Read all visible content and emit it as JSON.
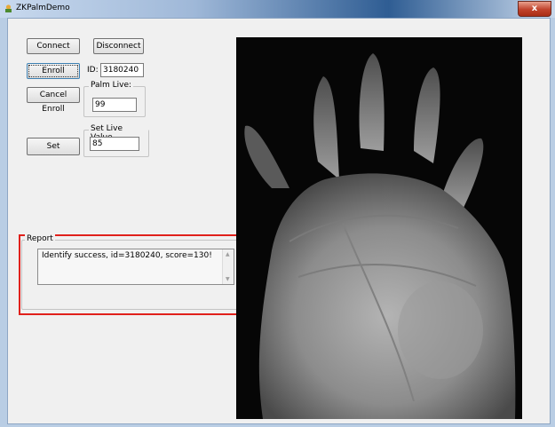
{
  "window": {
    "title": "ZKPalmDemo",
    "close_glyph": "x"
  },
  "buttons": {
    "connect": "Connect",
    "disconnect": "Disconnect",
    "enroll": "Enroll",
    "cancel_enroll": "Cancel Enroll",
    "set": "Set"
  },
  "id_field": {
    "label": "ID:",
    "value": "3180240"
  },
  "palm_live": {
    "title": "Palm Live:",
    "value": "99"
  },
  "set_live": {
    "title": "Set Live Value",
    "value": "85"
  },
  "report": {
    "title": "Report",
    "text": "Identify success, id=3180240, score=130!"
  },
  "palm_image": {
    "name": "palm-vein-image"
  },
  "colors": {
    "highlight": "#e0201b",
    "titlebar": "#2f5d93",
    "close": "#c0422b"
  }
}
